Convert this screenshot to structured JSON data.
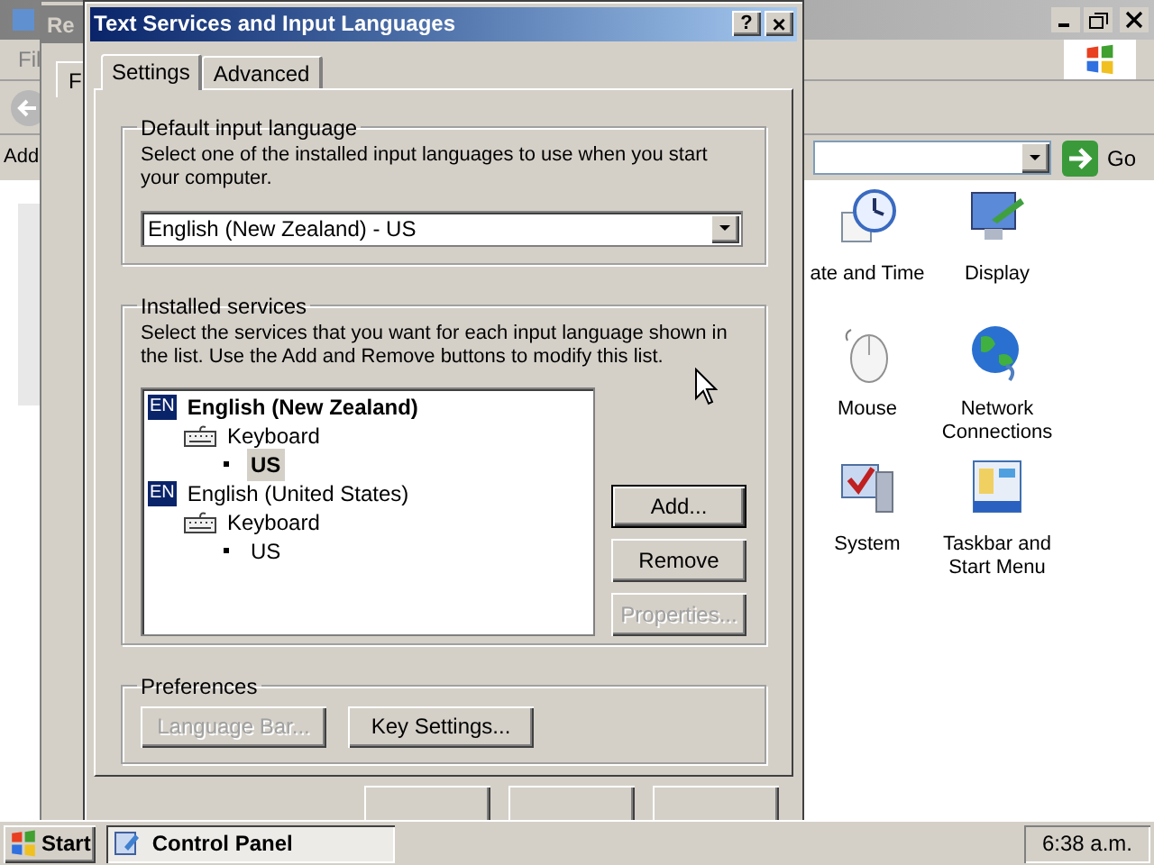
{
  "background_window": {
    "menu_bar": [
      "Fil"
    ],
    "address_label": "Add",
    "go_label": "Go",
    "icons": [
      {
        "label": "ate and Time",
        "kind": "clock"
      },
      {
        "label": "Display",
        "kind": "display"
      },
      {
        "label": "Mouse",
        "kind": "mouse"
      },
      {
        "label": "Network Connections",
        "kind": "globe"
      },
      {
        "label": "System",
        "kind": "system"
      },
      {
        "label": "Taskbar and Start Menu",
        "kind": "taskbar"
      }
    ]
  },
  "back_dialog": {
    "title": "Re",
    "tabs": [
      {
        "label": "F",
        "selected": true
      }
    ]
  },
  "dialog": {
    "title": "Text Services and Input Languages",
    "help": "?",
    "close": "×",
    "tabs": [
      {
        "label": "Settings",
        "selected": true
      },
      {
        "label": "Advanced",
        "selected": false
      }
    ],
    "default_group": {
      "title": "Default input language",
      "description": "Select one of the installed input languages to use when you start your computer.",
      "value": "English (New Zealand) - US"
    },
    "services_group": {
      "title": "Installed services",
      "description": "Select the services that you want for each input language shown in the list. Use the Add and Remove buttons to modify this list.",
      "tree": [
        {
          "kind": "language",
          "badge": "EN",
          "label": "English (New Zealand)",
          "bold": true,
          "selected": false,
          "children": [
            {
              "kind": "service",
              "label": "Keyboard",
              "bold": false,
              "selected": false,
              "children": [
                {
                  "kind": "layout",
                  "label": "US",
                  "bold": true,
                  "selected": true
                }
              ]
            }
          ]
        },
        {
          "kind": "language",
          "badge": "EN",
          "label": "English (United States)",
          "bold": false,
          "selected": false,
          "children": [
            {
              "kind": "service",
              "label": "Keyboard",
              "bold": false,
              "selected": false,
              "children": [
                {
                  "kind": "layout",
                  "label": "US",
                  "bold": false,
                  "selected": false
                }
              ]
            }
          ]
        }
      ],
      "buttons": [
        {
          "label": "Add...",
          "disabled": false,
          "default": true
        },
        {
          "label": "Remove",
          "disabled": false,
          "default": false
        },
        {
          "label": "Properties...",
          "disabled": true,
          "default": false
        }
      ]
    },
    "preferences_group": {
      "title": "Preferences",
      "buttons": [
        {
          "label": "Language Bar...",
          "disabled": true,
          "default": false
        },
        {
          "label": "Key Settings...",
          "disabled": false,
          "default": false
        }
      ]
    }
  },
  "taskbar": {
    "start": "Start",
    "tasks": [
      {
        "label": "Control Panel",
        "selected": true
      }
    ],
    "clock": "6:38 a.m."
  }
}
